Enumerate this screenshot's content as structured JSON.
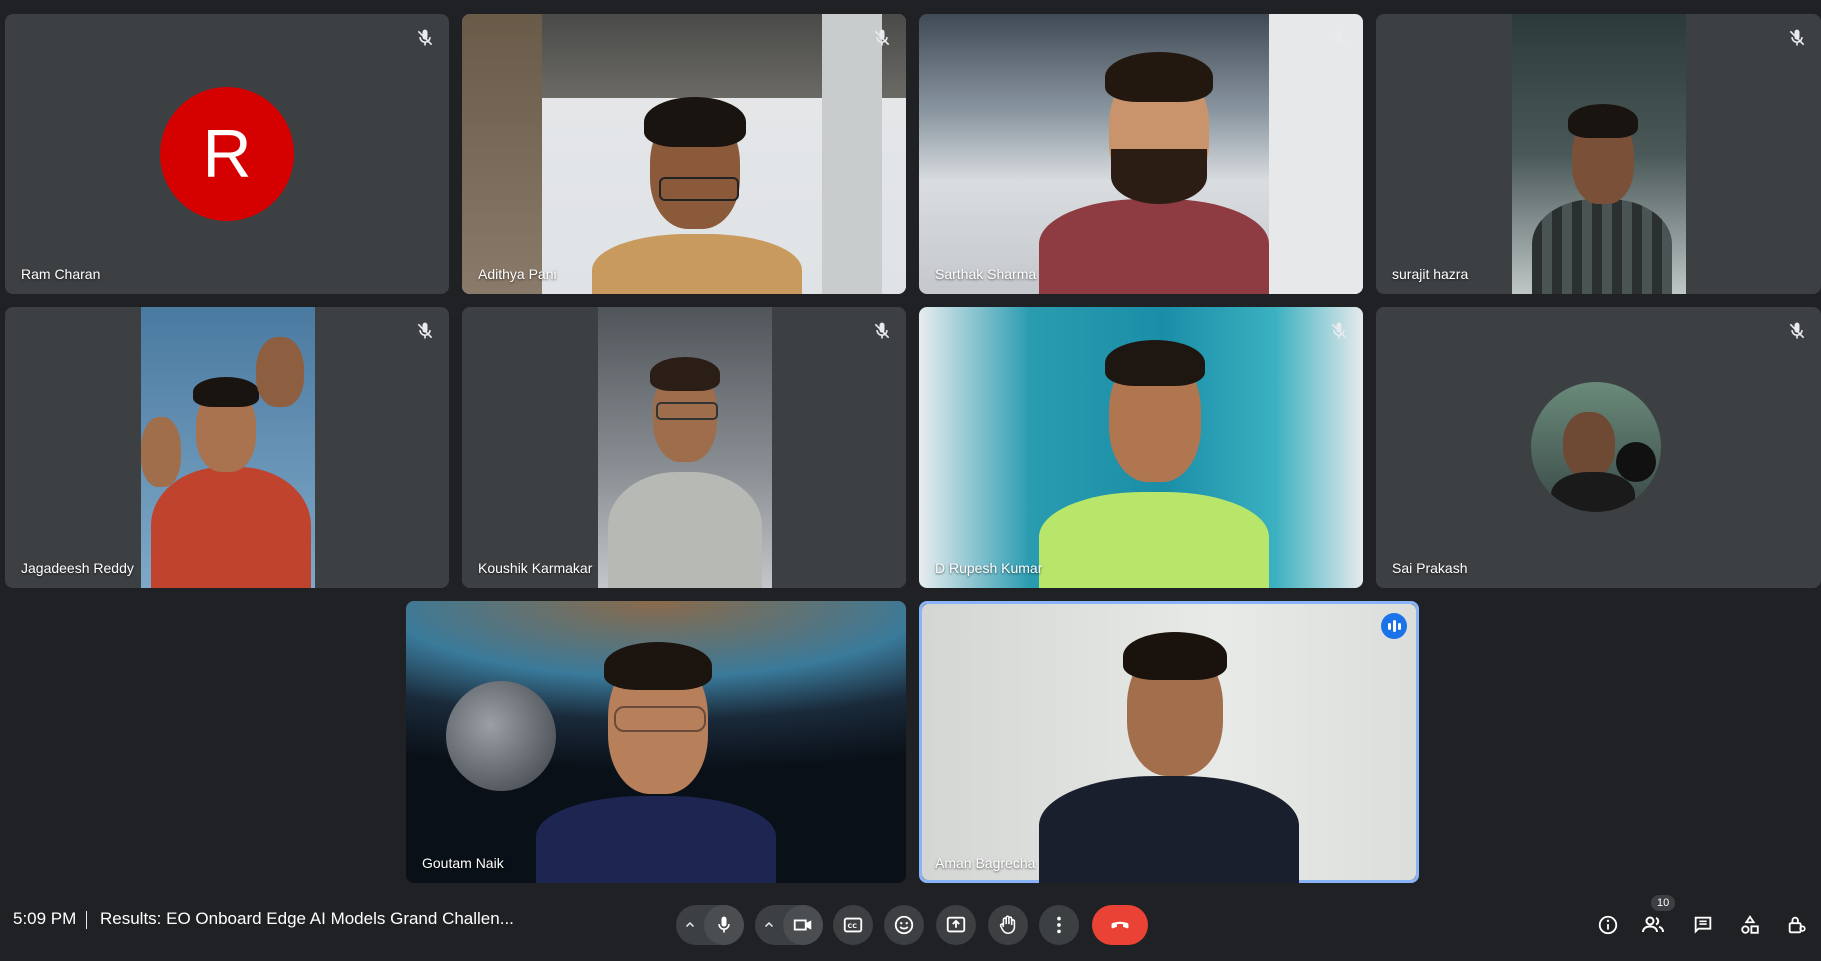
{
  "participants": [
    {
      "name": "Ram Charan",
      "avatar_letter": "R",
      "avatar_color": "#d50000",
      "muted": true
    },
    {
      "name": "Adithya Pani",
      "muted": true
    },
    {
      "name": "Sarthak Sharma",
      "muted": true
    },
    {
      "name": "surajit hazra",
      "muted": true
    },
    {
      "name": "Jagadeesh Reddy",
      "muted": true
    },
    {
      "name": "Koushik Karmakar",
      "muted": true
    },
    {
      "name": "D Rupesh Kumar",
      "muted": true
    },
    {
      "name": "Sai Prakash",
      "muted": true
    },
    {
      "name": "Goutam Naik",
      "muted": false
    },
    {
      "name": "Aman Bagrecha",
      "muted": false,
      "speaking": true
    }
  ],
  "bottom_bar": {
    "time": "5:09 PM",
    "meeting_title": "Results: EO Onboard Edge AI Models Grand Challen...",
    "participant_count": "10"
  },
  "colors": {
    "background": "#202124",
    "tile": "#3c4043",
    "active_speaker_border": "#8ab4f8",
    "end_call": "#ea4335"
  },
  "icons": [
    "mic-icon",
    "camera-icon",
    "captions-icon",
    "emoji-icon",
    "present-icon",
    "raise-hand-icon",
    "more-options-icon",
    "end-call-icon",
    "info-icon",
    "people-icon",
    "chat-icon",
    "activities-icon",
    "host-controls-icon"
  ]
}
